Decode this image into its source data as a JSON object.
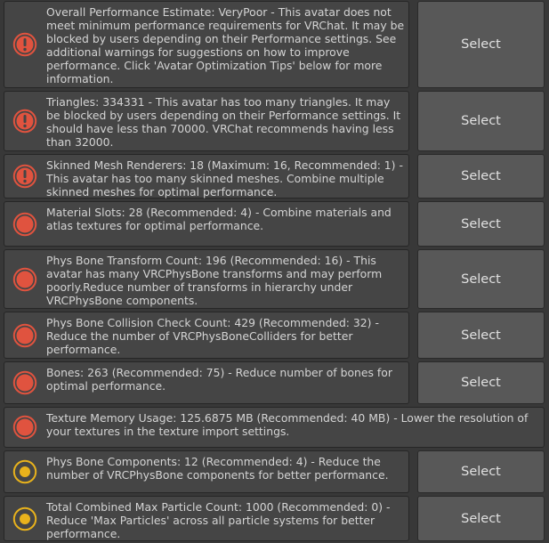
{
  "select_label": "Select",
  "colors": {
    "error": "#e0533f",
    "warning": "#e8b21c"
  },
  "rows": [
    {
      "icon": "exclamation-error-icon",
      "text": "Overall Performance Estimate: VeryPoor - This avatar does not meet minimum performance requirements for VRChat. It may be blocked by users depending on their Performance settings. See additional warnings for suggestions on how to improve performance. Click 'Avatar Optimization Tips' below for more information.",
      "has_select": true
    },
    {
      "icon": "exclamation-error-icon",
      "text": "Triangles: 334331 - This avatar has too many triangles. It may be blocked by users depending on their Performance settings. It should have less than 70000. VRChat recommends having less than 32000.",
      "has_select": true
    },
    {
      "icon": "exclamation-error-icon",
      "text": "Skinned Mesh Renderers: 18 (Maximum: 16, Recommended: 1) - This avatar has too many skinned meshes. Combine multiple skinned meshes for optimal performance.",
      "has_select": true
    },
    {
      "icon": "red-circle-icon",
      "text": "Material Slots: 28 (Recommended: 4) - Combine materials and atlas textures for optimal performance.",
      "has_select": true
    },
    {
      "icon": "red-circle-icon",
      "text": "Phys Bone Transform Count: 196 (Recommended: 16) - This avatar has many VRCPhysBone transforms and may perform poorly.Reduce number of transforms in hierarchy under VRCPhysBone components.",
      "has_select": true
    },
    {
      "icon": "red-circle-icon",
      "text": "Phys Bone Collision Check Count: 429 (Recommended: 32) - Reduce the number of VRCPhysBoneColliders for better performance.",
      "has_select": true
    },
    {
      "icon": "red-circle-icon",
      "text": "Bones: 263 (Recommended: 75) - Reduce number of bones for optimal performance.",
      "has_select": true
    },
    {
      "icon": "red-circle-icon",
      "text": "Texture Memory Usage: 125.6875 MB (Recommended: 40 MB) - Lower the resolution of your textures in the texture import settings.",
      "has_select": false
    },
    {
      "icon": "yellow-circle-icon",
      "text": "Phys Bone Components: 12 (Recommended: 4) - Reduce the number of VRCPhysBone components for better performance.",
      "has_select": true
    },
    {
      "icon": "yellow-circle-icon",
      "text": "Total Combined Max Particle Count: 1000 (Recommended: 0) - Reduce 'Max Particles' across all particle systems for better performance.",
      "has_select": true
    }
  ]
}
